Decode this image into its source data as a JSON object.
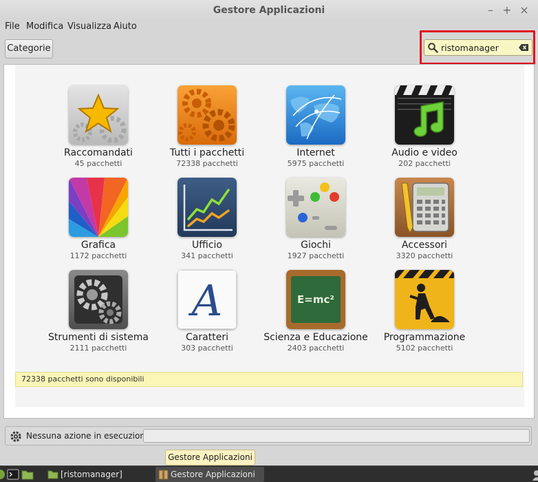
{
  "window": {
    "title": "Gestore Applicazioni"
  },
  "window_controls": {
    "minimize": "–",
    "maximize": "+",
    "close": "×"
  },
  "menu": {
    "file": "File",
    "edit": "Modifica",
    "view": "Visualizza",
    "help": "Aiuto"
  },
  "toolbar": {
    "categories_label": "Categorie"
  },
  "search": {
    "value": "ristomanager",
    "highlight_color": "#e0101c"
  },
  "categories": [
    {
      "name": "Raccomandati",
      "count": "45 pacchetti",
      "icon": "star-icon"
    },
    {
      "name": "Tutti i pacchetti",
      "count": "72338 pacchetti",
      "icon": "gears-icon"
    },
    {
      "name": "Internet",
      "count": "5975 pacchetti",
      "icon": "globe-icon"
    },
    {
      "name": "Audio e video",
      "count": "202 pacchetti",
      "icon": "clapperboard-icon"
    },
    {
      "name": "Grafica",
      "count": "1172 pacchetti",
      "icon": "color-wheel-icon"
    },
    {
      "name": "Ufficio",
      "count": "341 pacchetti",
      "icon": "chart-icon"
    },
    {
      "name": "Giochi",
      "count": "1927 pacchetti",
      "icon": "gamepad-icon"
    },
    {
      "name": "Accessori",
      "count": "3320 pacchetti",
      "icon": "calculator-icon"
    },
    {
      "name": "Strumenti di sistema",
      "count": "2111 pacchetti",
      "icon": "system-gears-icon"
    },
    {
      "name": "Caratteri",
      "count": "303 pacchetti",
      "icon": "font-icon"
    },
    {
      "name": "Scienza e Educazione",
      "count": "2403 pacchetti",
      "icon": "chalkboard-icon"
    },
    {
      "name": "Programmazione",
      "count": "5102 pacchetti",
      "icon": "construction-icon"
    }
  ],
  "chalkboard_text": "E=mc²",
  "font_icon_letter": "A",
  "info": {
    "text": "72338 pacchetti sono disponibili"
  },
  "status": {
    "text": "Nessuna azione in esecuzione"
  },
  "taskbar": {
    "items": [
      {
        "label": "[ristomanager]",
        "icon": "folder-icon"
      },
      {
        "label": "Gestore Applicazioni",
        "icon": "package-icon"
      }
    ]
  },
  "tooltip": {
    "text": "Gestore Applicazioni"
  }
}
